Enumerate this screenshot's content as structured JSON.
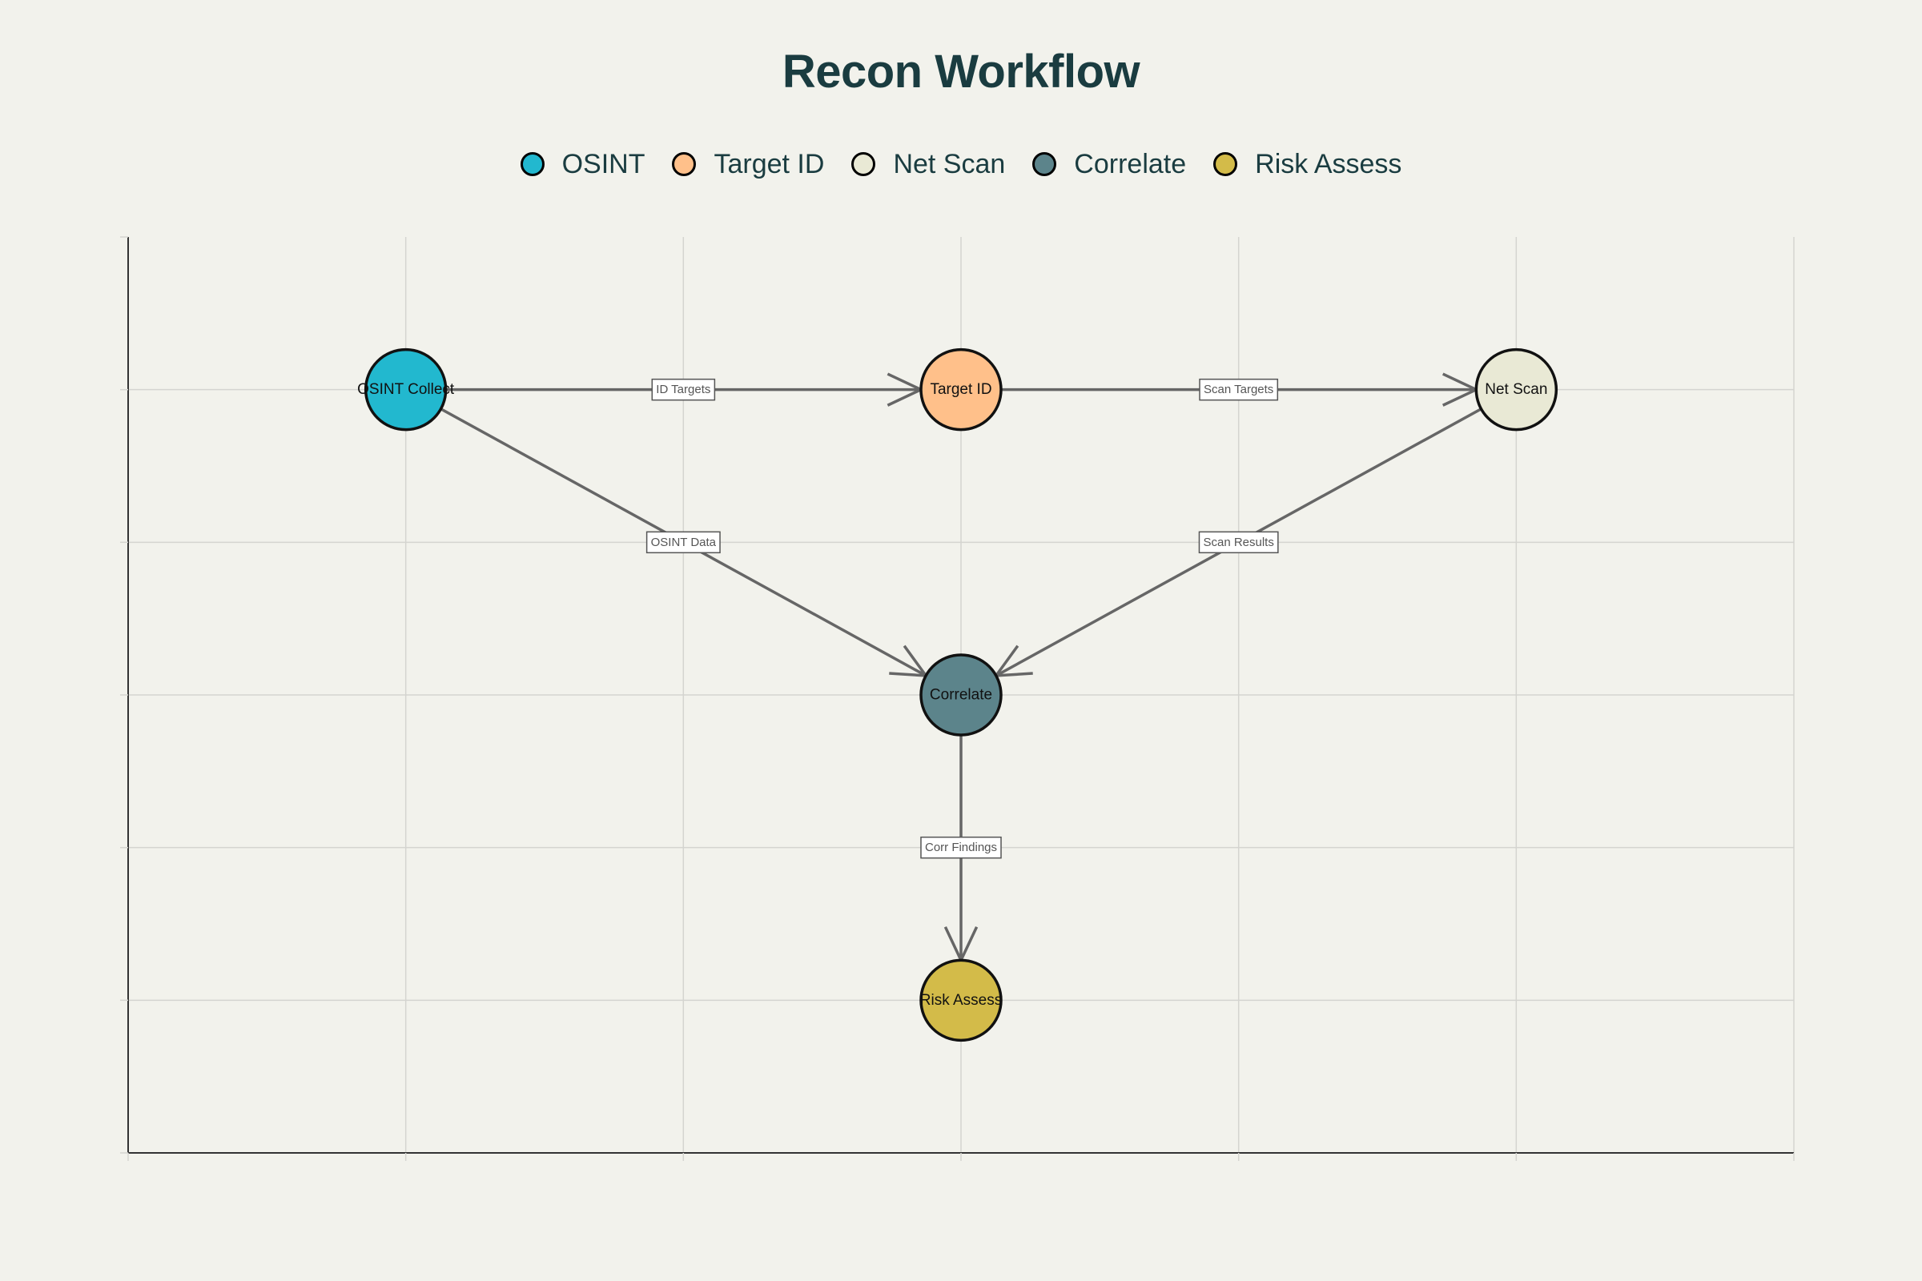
{
  "title": "Recon Workflow",
  "legend": [
    {
      "label": "OSINT",
      "color": "#22b8cf"
    },
    {
      "label": "Target ID",
      "color": "#ffc08a"
    },
    {
      "label": "Net Scan",
      "color": "#e9e9d5"
    },
    {
      "label": "Correlate",
      "color": "#5c848b"
    },
    {
      "label": "Risk Assess",
      "color": "#d3bb49"
    }
  ],
  "nodes": [
    {
      "id": "osint",
      "label": "OSINT Collect",
      "color": "#22b8cf"
    },
    {
      "id": "target",
      "label": "Target ID",
      "color": "#ffc08a"
    },
    {
      "id": "netscan",
      "label": "Net Scan",
      "color": "#e9e9d5"
    },
    {
      "id": "correlate",
      "label": "Correlate",
      "color": "#5c848b"
    },
    {
      "id": "risk",
      "label": "Risk Assess",
      "color": "#d3bb49"
    }
  ],
  "edges": [
    {
      "from": "osint",
      "to": "target",
      "label": "ID Targets"
    },
    {
      "from": "target",
      "to": "netscan",
      "label": "Scan Targets"
    },
    {
      "from": "osint",
      "to": "correlate",
      "label": "OSINT Data"
    },
    {
      "from": "netscan",
      "to": "correlate",
      "label": "Scan Results"
    },
    {
      "from": "correlate",
      "to": "risk",
      "label": "Corr Findings"
    }
  ],
  "colors": {
    "background": "#f2f2ec",
    "title": "#1a3c40",
    "edge": "#666666",
    "grid": "#d4d4d0",
    "axis": "#333333"
  }
}
